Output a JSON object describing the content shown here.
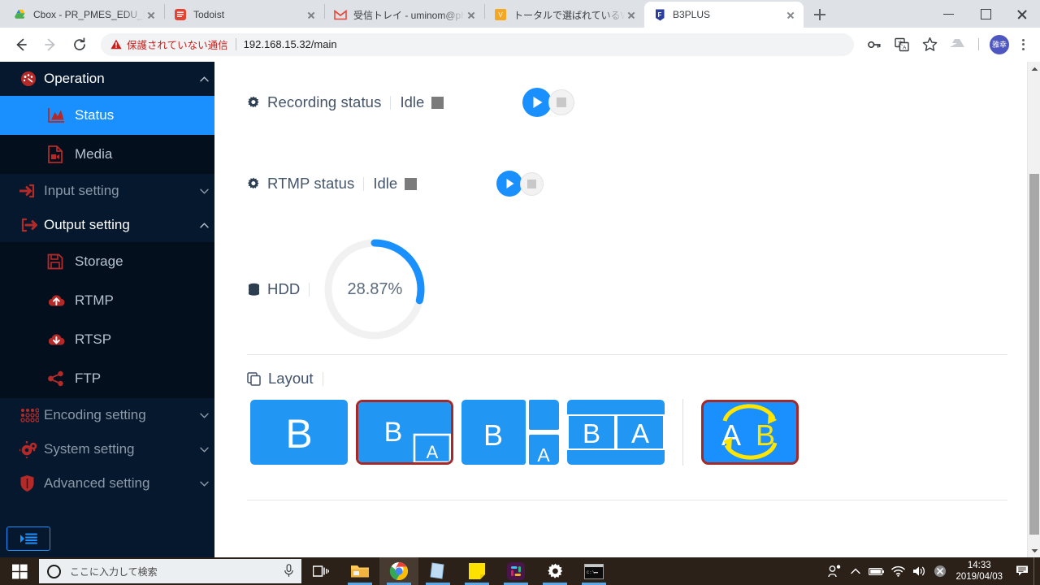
{
  "browser": {
    "tabs": [
      {
        "title": "Cbox - PR_PMES_EDU_PRIV",
        "favicon": "google-drive-icon",
        "active": false
      },
      {
        "title": "Todoist",
        "favicon": "todoist-icon",
        "active": false
      },
      {
        "title": "受信トレイ - uminom@photr",
        "favicon": "gmail-icon",
        "active": false
      },
      {
        "title": "トータルで選ばれているWeb会",
        "favicon": "v-cube-icon",
        "active": false
      },
      {
        "title": "B3PLUS",
        "favicon": "b3plus-icon",
        "active": true
      }
    ],
    "new_tab_label": "+",
    "window_controls": {
      "minimize": "—",
      "maximize": "❐",
      "close": "✕"
    },
    "toolbar": {
      "back": "←",
      "forward": "→",
      "reload": "⟳",
      "security_warning": "保護されていない通信",
      "url_host": "192.168.15.32",
      "url_path": "/main",
      "icons": [
        "password-key-icon",
        "translate-icon",
        "bookmark-star-icon",
        "drive-upload-icon"
      ],
      "avatar_initials": "雅幸",
      "menu": "⋮"
    }
  },
  "sidebar": {
    "groups": [
      {
        "label": "Operation",
        "icon": "dashboard-gauge-icon",
        "expanded": true,
        "chevron": "chevron-up-icon",
        "items": [
          {
            "label": "Status",
            "icon": "area-chart-icon",
            "active": true
          },
          {
            "label": "Media",
            "icon": "media-file-icon",
            "active": false
          }
        ]
      },
      {
        "label": "Input setting",
        "icon": "input-arrow-icon",
        "expanded": false,
        "chevron": "chevron-down-icon",
        "items": []
      },
      {
        "label": "Output setting",
        "icon": "output-arrow-icon",
        "expanded": true,
        "chevron": "chevron-up-icon",
        "items": [
          {
            "label": "Storage",
            "icon": "floppy-disk-icon",
            "active": false
          },
          {
            "label": "RTMP",
            "icon": "cloud-upload-icon",
            "active": false
          },
          {
            "label": "RTSP",
            "icon": "cloud-download-icon",
            "active": false
          },
          {
            "label": "FTP",
            "icon": "share-nodes-icon",
            "active": false
          }
        ]
      },
      {
        "label": "Encoding setting",
        "icon": "dots-grid-icon",
        "expanded": false,
        "chevron": "chevron-down-icon",
        "items": []
      },
      {
        "label": "System setting",
        "icon": "gears-icon",
        "expanded": false,
        "chevron": "chevron-down-icon",
        "items": []
      },
      {
        "label": "Advanced setting",
        "icon": "shield-icon",
        "expanded": false,
        "chevron": "chevron-down-icon",
        "items": []
      }
    ],
    "collapse_toggle_icon": "sidebar-collapse-icon"
  },
  "main": {
    "rows": [
      {
        "label": "Recording status",
        "icon": "gear-icon",
        "value": "Idle",
        "state_swatch_color": "#7b7b7b",
        "play_label": "start-recording",
        "stop_label": "stop-recording",
        "play_size": 36,
        "stop_size": 32
      },
      {
        "label": "RTMP status",
        "icon": "gear-icon",
        "value": "Idle",
        "state_swatch_color": "#7b7b7b",
        "play_label": "start-rtmp",
        "stop_label": "stop-rtmp",
        "play_size": 32,
        "stop_size": 28
      }
    ],
    "hdd": {
      "label": "HDD",
      "icon": "database-icon",
      "percent_text": "28.87%",
      "percent_value": 28.87,
      "arc_color": "#1a90ff",
      "track_color": "#f0f0f0"
    },
    "layout": {
      "title": "Layout",
      "icon": "copy-icon",
      "options": [
        {
          "name": "full-b",
          "selected": false,
          "labels": [
            "B"
          ]
        },
        {
          "name": "b-with-pip-a",
          "selected": true,
          "labels": [
            "B",
            "A"
          ]
        },
        {
          "name": "b-sidebar-a",
          "selected": false,
          "labels": [
            "B",
            "A"
          ]
        },
        {
          "name": "b-and-a-split",
          "selected": false,
          "labels": [
            "B",
            "A"
          ]
        }
      ],
      "swap": {
        "name": "swap-a-b",
        "selected": true,
        "label_a": "A",
        "label_b": "B",
        "arrow_color": "#ffe500"
      }
    }
  },
  "taskbar": {
    "search_placeholder": "ここに入力して検索",
    "start_icon": "windows-start-icon",
    "search_icon": "cortana-circle-icon",
    "mic_icon": "microphone-icon",
    "tasks": [
      {
        "name": "task-view-icon",
        "running": false,
        "focused": false
      },
      {
        "name": "file-explorer-icon",
        "running": true,
        "focused": false
      },
      {
        "name": "google-chrome-icon",
        "running": true,
        "focused": true
      },
      {
        "name": "sticky-notes-icon",
        "running": true,
        "focused": false
      },
      {
        "name": "notepad-icon",
        "running": true,
        "focused": false
      },
      {
        "name": "slack-icon",
        "running": true,
        "focused": false
      },
      {
        "name": "settings-gear-icon",
        "running": true,
        "focused": false
      },
      {
        "name": "command-prompt-icon",
        "running": true,
        "focused": false
      }
    ],
    "tray_icons": [
      "people-icon",
      "show-hidden-icons-icon",
      "battery-icon",
      "wifi-icon",
      "volume-icon",
      "error-badge-icon"
    ],
    "clock_time": "14:33",
    "clock_date": "2019/04/03",
    "action_center_icon": "action-center-icon"
  }
}
